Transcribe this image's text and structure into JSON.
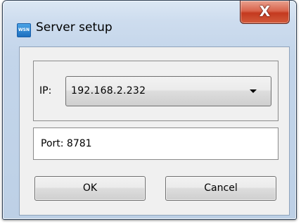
{
  "window": {
    "title": "Server setup",
    "icon_text": "WSN",
    "close_glyph": "X"
  },
  "ip": {
    "label": "IP:",
    "selected": "192.168.2.232"
  },
  "port": {
    "text": "Port: 8781"
  },
  "buttons": {
    "ok": "OK",
    "cancel": "Cancel"
  },
  "colors": {
    "close_button": "#c8432b",
    "frame": "#c3d5ea",
    "client": "#f0f0f0"
  }
}
